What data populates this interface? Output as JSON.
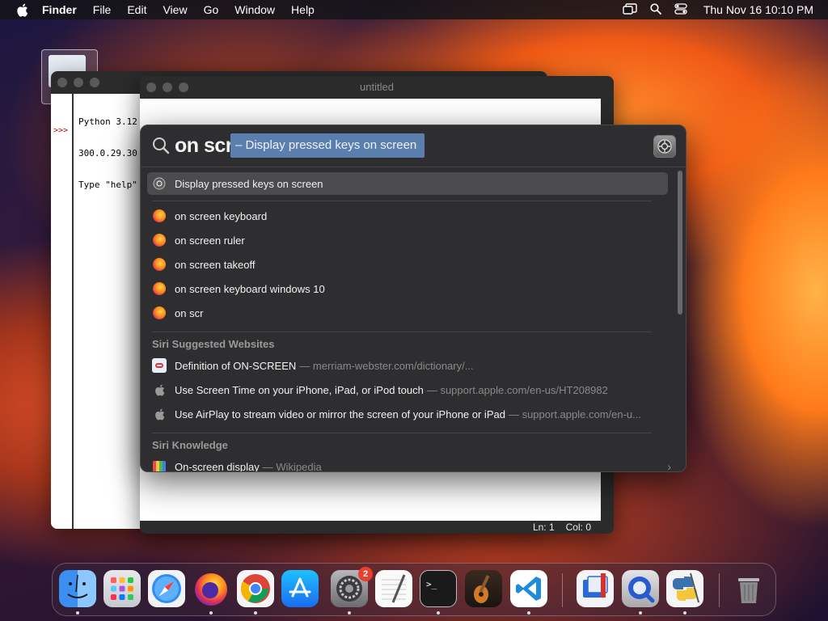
{
  "menubar": {
    "app_name": "Finder",
    "items": [
      "File",
      "Edit",
      "View",
      "Go",
      "Window",
      "Help"
    ],
    "clock": "Thu Nov 16  10:10 PM"
  },
  "python_shell": {
    "lines": [
      "Python 3.12",
      "300.0.29.30",
      "Type \"help\""
    ],
    "prompt": ">>>"
  },
  "editor": {
    "title": "untitled",
    "status_line": "Ln: 1",
    "status_col": "Col: 0"
  },
  "spotlight": {
    "query": "on scr",
    "completion": "– Display pressed keys on screen",
    "top_hit": "Display pressed keys on screen",
    "suggestions": [
      "on screen keyboard",
      "on screen ruler",
      "on screen takeoff",
      "on screen keyboard windows 10",
      "on scr"
    ],
    "siri_websites_header": "Siri Suggested Websites",
    "websites": [
      {
        "title": "Definition of ON-SCREEN",
        "url": "— merriam-webster.com/dictionary/..."
      },
      {
        "title": "Use Screen Time on your iPhone, iPad, or iPod touch",
        "url": "— support.apple.com/en-us/HT208982"
      },
      {
        "title": "Use AirPlay to stream video or mirror the screen of your iPhone or iPad",
        "url": "— support.apple.com/en-u..."
      }
    ],
    "siri_knowledge_header": "Siri Knowledge",
    "knowledge": {
      "title": "On-screen display",
      "source": "— Wikipedia"
    }
  },
  "dock": {
    "settings_badge": "2",
    "apps": [
      "finder-icon",
      "launchpad-icon",
      "safari-icon",
      "firefox-icon",
      "chrome-icon",
      "app-store-icon",
      "system-settings-icon",
      "textedit-icon",
      "terminal-icon",
      "garageband-icon",
      "vscode-icon",
      "remote-desktop-icon",
      "quicktime-icon",
      "python-launcher-icon",
      "trash-icon"
    ]
  },
  "colors": {
    "completion_highlight": "#5a7fae",
    "spotlight_bg": "#2e2e30",
    "badge_red": "#e8402e"
  }
}
